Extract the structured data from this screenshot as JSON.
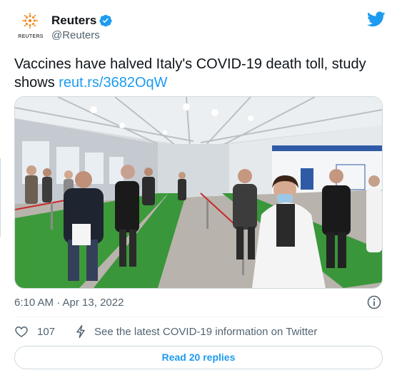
{
  "account": {
    "display_name": "Reuters",
    "handle": "@Reuters",
    "logo_text": "REUTERS",
    "verified": true,
    "avatar_icon": "reuters-logo",
    "platform_icon": "twitter-bird-icon"
  },
  "tweet": {
    "text": "Vaccines have halved Italy's COVID-19 death toll, study shows ",
    "link": "reut.rs/3682OqW",
    "image_icon": "vaccination-center-photo",
    "timestamp": "6:10 AM · Apr 13, 2022"
  },
  "actions": {
    "like_count": "107",
    "covid_text": "See the latest COVID-19 information on Twitter",
    "read_replies": "Read 20 replies"
  },
  "colors": {
    "accent": "#1d9bf0",
    "text": "#0f1419",
    "muted": "#536471",
    "border": "#cfd9de",
    "logo_orange": "#f08a24"
  }
}
